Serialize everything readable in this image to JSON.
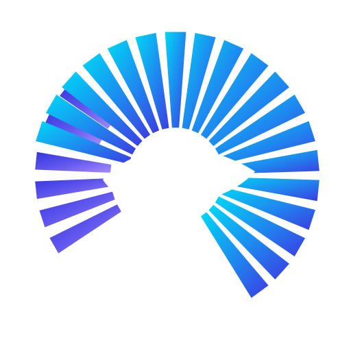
{
  "logo": {
    "name": "striped-sphere-logo",
    "colors": {
      "front_start": "#00d7f5",
      "front_mid": "#1f86ef",
      "front_end": "#3b3de2",
      "back_start": "#3434e0",
      "back_mid": "#6157ee",
      "back_end": "#a78bfa"
    }
  }
}
